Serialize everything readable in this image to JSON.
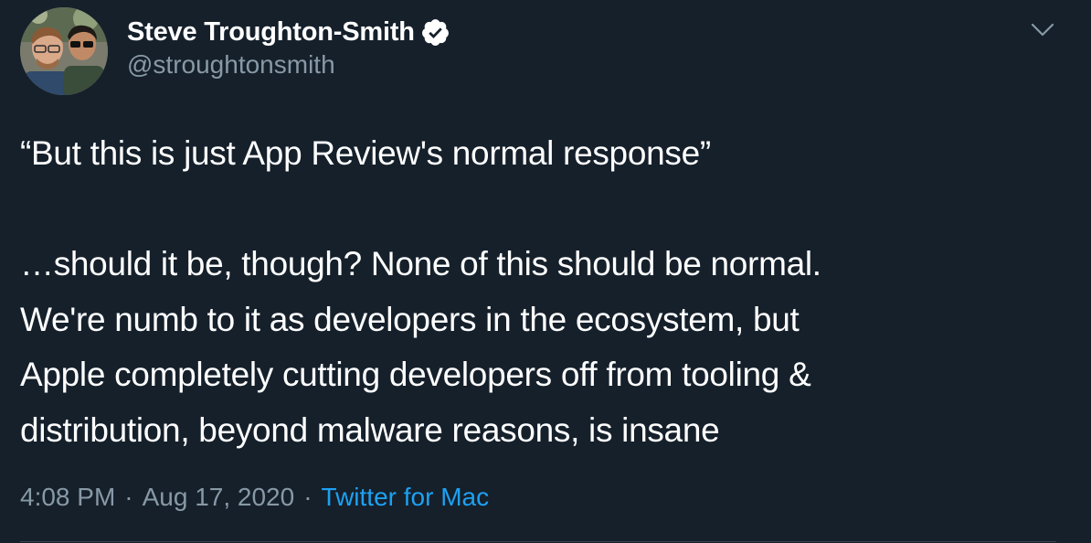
{
  "tweet": {
    "author": {
      "display_name": "Steve Troughton-Smith",
      "handle": "@stroughtonsmith",
      "verified_icon": "verified-badge-icon",
      "avatar_icon": "avatar"
    },
    "menu_icon": "chevron-down-icon",
    "text_line_1": "“But this is just App Review's normal response”",
    "text_line_2": "…should it be, though? None of this should be normal.",
    "text_line_3": "We're numb to it as developers in the ecosystem, but",
    "text_line_4": "Apple completely cutting developers off from tooling &",
    "text_line_5": "distribution, beyond malware reasons, is insane",
    "meta": {
      "time": "4:08 PM",
      "separator": "·",
      "date": "Aug 17, 2020",
      "source": "Twitter for Mac"
    }
  },
  "colors": {
    "background": "#15202b",
    "primary_text": "#ffffff",
    "secondary_text": "#8899a6",
    "link": "#1da1f2",
    "divider": "#38444d"
  }
}
